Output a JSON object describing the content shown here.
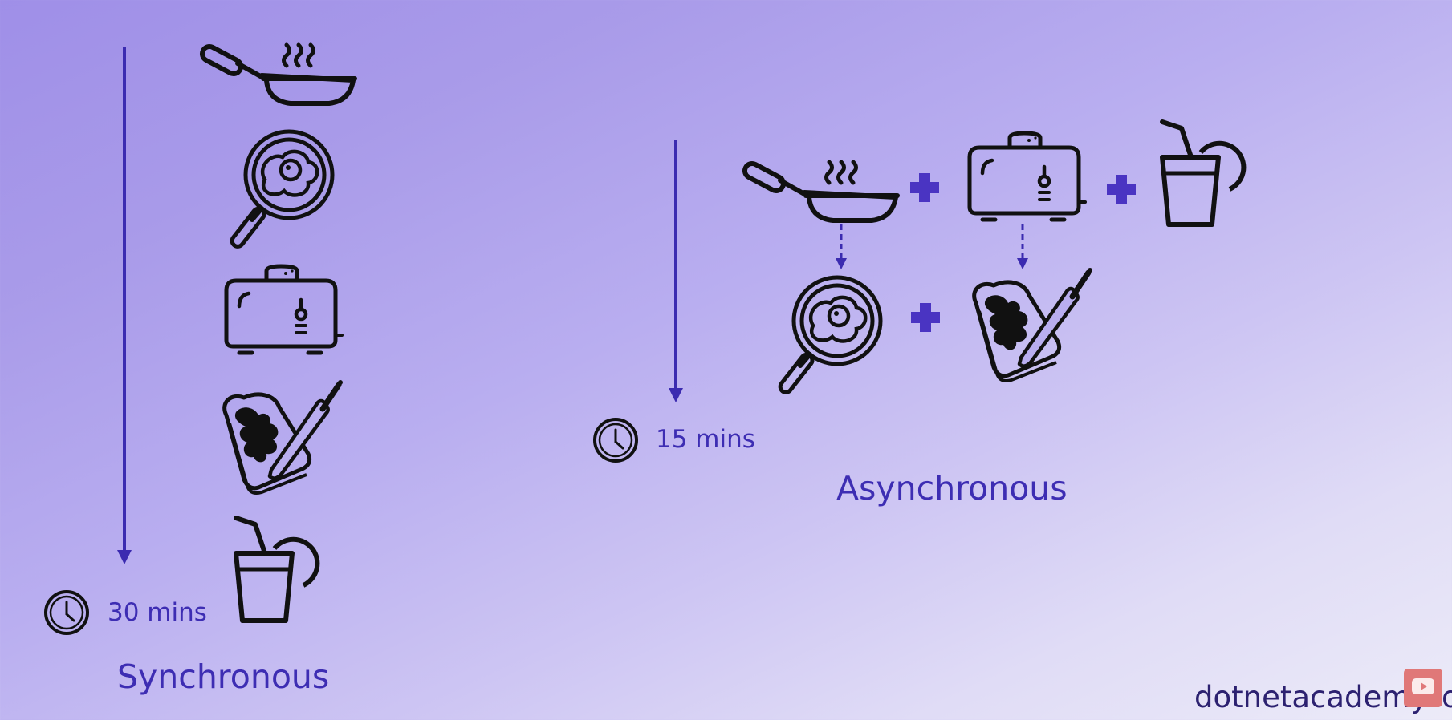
{
  "sync": {
    "title": "Synchronous",
    "time": "30 mins"
  },
  "async": {
    "title": "Asynchronous",
    "time": "15 mins"
  },
  "brand": "dotnetacademy.io",
  "icons": {
    "pan": "frying-pan-steam-icon",
    "egg": "fried-egg-pan-icon",
    "toaster": "toaster-icon",
    "toast": "buttered-toast-knife-icon",
    "drink": "juice-glass-icon",
    "clock": "clock-icon",
    "plus": "plus-icon",
    "youtube": "youtube-subscribe-icon"
  },
  "colors": {
    "accent": "#3d2db3",
    "icon": "#111111",
    "arrow": "#3b2bb0"
  }
}
